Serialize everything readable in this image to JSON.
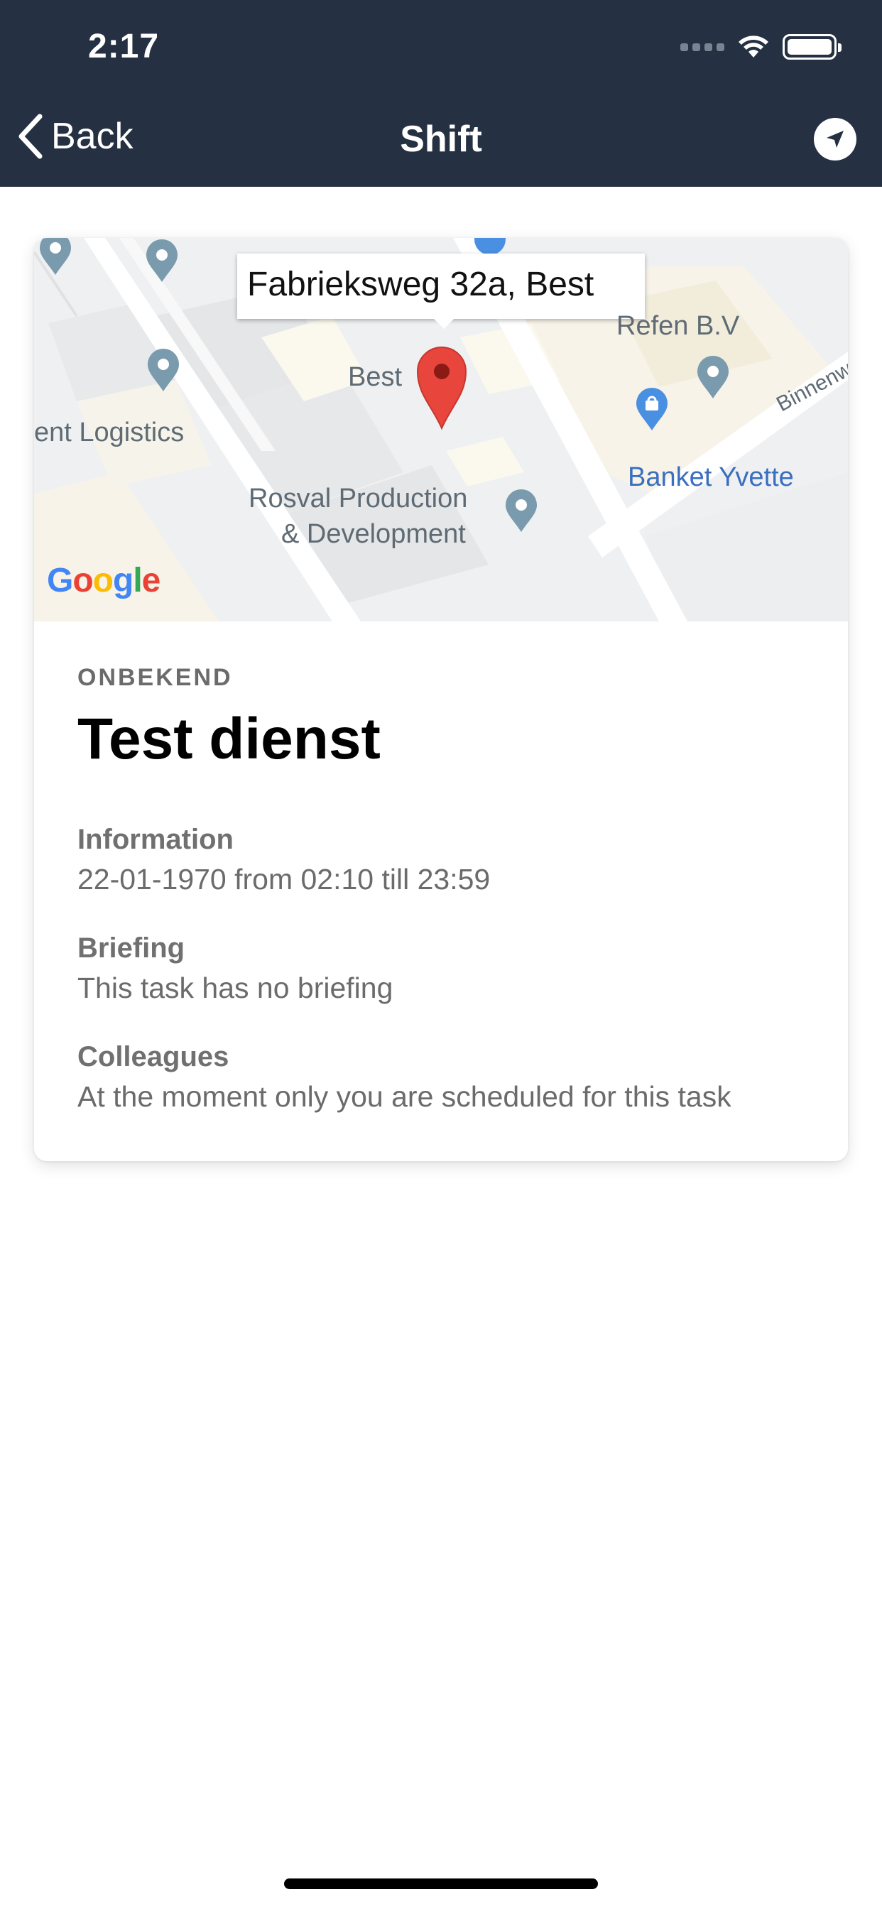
{
  "status_bar": {
    "time": "2:17"
  },
  "nav": {
    "back_label": "Back",
    "title": "Shift"
  },
  "map": {
    "tooltip": "Fabrieksweg 32a, Best",
    "labels": {
      "refen": "Refen B.V",
      "best": "Best",
      "logistics": "ent Logistics",
      "binnen": "Binnenw",
      "banket": "Banket Yvette",
      "rosval_1": "Rosval Production",
      "rosval_2": "& Development"
    },
    "google_logo": "Google"
  },
  "shift": {
    "category": "ONBEKEND",
    "title": "Test dienst",
    "information_label": "Information",
    "information_value": "22-01-1970 from 02:10 till 23:59",
    "briefing_label": "Briefing",
    "briefing_value": "This task has no briefing",
    "colleagues_label": "Colleagues",
    "colleagues_value": "At the moment only you are scheduled for this task"
  },
  "colors": {
    "header": "#253142",
    "pin_red": "#e8453c",
    "pin_gray": "#7a9aad",
    "pin_blue": "#4a90e2"
  }
}
